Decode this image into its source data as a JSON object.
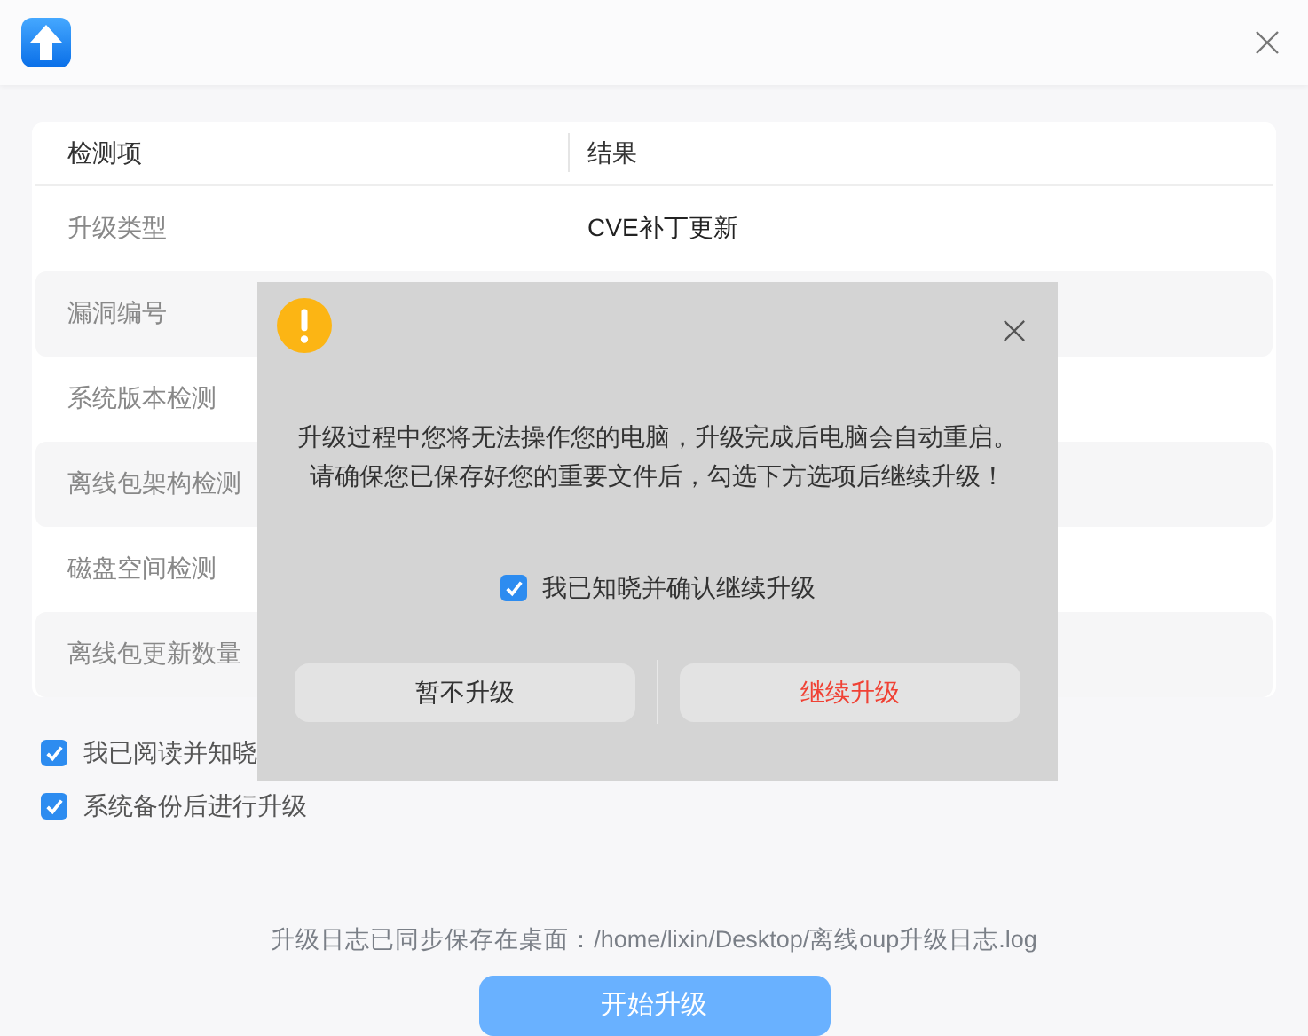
{
  "table": {
    "columns": [
      "检测项",
      "结果"
    ],
    "rows": [
      {
        "item": "升级类型",
        "result": "CVE补丁更新"
      },
      {
        "item": "漏洞编号"
      },
      {
        "item": "系统版本检测"
      },
      {
        "item": "离线包架构检测"
      },
      {
        "item": "磁盘空间检测"
      },
      {
        "item": "离线包更新数量"
      }
    ]
  },
  "options": [
    {
      "label": "我已阅读并知晓",
      "checked": true
    },
    {
      "label": "系统备份后进行升级",
      "checked": true
    }
  ],
  "log_note": {
    "label": "升级日志已同步保存在桌面：",
    "path": "/home/lixin/Desktop/离线oup升级日志.log"
  },
  "start_button": "开始升级",
  "dialog": {
    "message": [
      "升级过程中您将无法操作您的电脑，升级完成后电脑会自动重启。",
      "请确保您已保存好您的重要文件后，勾选下方选项后继续升级！"
    ],
    "confirm": {
      "label": "我已知晓并确认继续升级",
      "checked": true
    },
    "buttons": [
      {
        "label": "暂不升级",
        "kind": "normal"
      },
      {
        "label": "继续升级",
        "kind": "warning"
      }
    ]
  }
}
